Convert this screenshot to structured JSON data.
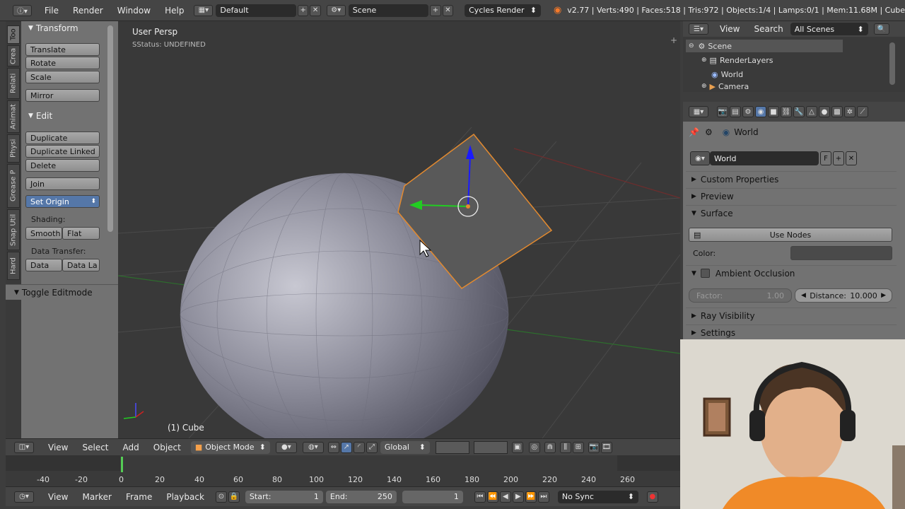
{
  "topbar": {
    "menus": [
      "File",
      "Render",
      "Window",
      "Help"
    ],
    "layout": "Default",
    "scene": "Scene",
    "engine": "Cycles Render",
    "stats": "v2.77 | Verts:490 | Faces:518 | Tris:972 | Objects:1/4 | Lamps:0/1 | Mem:11.68M | Cube"
  },
  "tabs": [
    "Too",
    "Crea",
    "Relati",
    "Animat",
    "Physi",
    "Grease P",
    "Snap Util",
    "Hard"
  ],
  "toolshelf": {
    "transform_title": "Transform",
    "translate": "Translate",
    "rotate": "Rotate",
    "scale": "Scale",
    "mirror": "Mirror",
    "edit_title": "Edit",
    "duplicate": "Duplicate",
    "duplicate_linked": "Duplicate Linked",
    "delete": "Delete",
    "join": "Join",
    "set_origin": "Set Origin",
    "shading_label": "Shading:",
    "smooth": "Smooth",
    "flat": "Flat",
    "data_transfer_label": "Data Transfer:",
    "data": "Data",
    "data_la": "Data La",
    "toggle_editmode": "Toggle Editmode"
  },
  "viewport": {
    "view_name": "User Persp",
    "status": "SStatus: UNDEFINED",
    "object_label": "(1) Cube"
  },
  "vpheader": {
    "menus": [
      "View",
      "Select",
      "Add",
      "Object"
    ],
    "mode": "Object Mode",
    "orientation": "Global"
  },
  "timeline": {
    "ticks": [
      "-40",
      "-20",
      "0",
      "20",
      "40",
      "60",
      "80",
      "100",
      "120",
      "140",
      "160",
      "180",
      "200",
      "220",
      "240",
      "260"
    ],
    "menus": [
      "View",
      "Marker",
      "Frame",
      "Playback"
    ],
    "start_label": "Start:",
    "start_value": "1",
    "end_label": "End:",
    "end_value": "250",
    "current_frame": "1",
    "sync": "No Sync"
  },
  "outliner": {
    "view": "View",
    "search": "Search",
    "filter": "All Scenes",
    "items": [
      "Scene",
      "RenderLayers",
      "World",
      "Camera"
    ]
  },
  "properties": {
    "context": "World",
    "datablock": "World",
    "fake_user": "F",
    "sections": {
      "custom_properties": "Custom Properties",
      "preview": "Preview",
      "surface": "Surface",
      "use_nodes": "Use Nodes",
      "color_label": "Color:",
      "ambient_occlusion": "Ambient Occlusion",
      "factor_label": "Factor:",
      "factor_value": "1.00",
      "distance_label": "Distance:",
      "distance_value": "10.000",
      "ray_visibility": "Ray Visibility",
      "settings": "Settings"
    }
  },
  "colors": {
    "selection_outline": "#e38a2f",
    "axis_z": "#1a1aff",
    "axis_y": "#22cc22",
    "axis_x": "#cc2222"
  }
}
